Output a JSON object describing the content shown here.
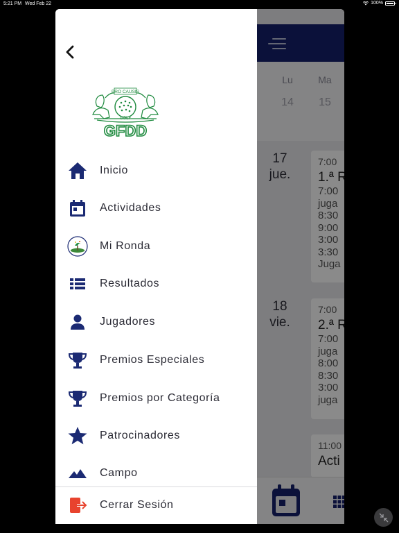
{
  "status_bar": {
    "time": "5:21 PM",
    "date": "Wed Feb 22",
    "battery": "100%"
  },
  "drawer": {
    "back_icon": "chevron-left-icon",
    "logo": {
      "motto": "PRO CAUSIS",
      "golf": "GOLF",
      "name": "GFDD"
    },
    "menu_items": [
      {
        "label": "Inicio",
        "icon": "home-icon"
      },
      {
        "label": "Actividades",
        "icon": "calendar-icon"
      },
      {
        "label": "Mi Ronda",
        "icon": "golf-ball-icon"
      },
      {
        "label": "Resultados",
        "icon": "list-icon"
      },
      {
        "label": "Jugadores",
        "icon": "person-icon"
      },
      {
        "label": "Premios Especiales",
        "icon": "trophy-icon"
      },
      {
        "label": "Premios por Categoría",
        "icon": "trophy-icon"
      },
      {
        "label": "Patrocinadores",
        "icon": "star-icon"
      },
      {
        "label": "Campo",
        "icon": "mountain-icon"
      }
    ],
    "logout": {
      "label": "Cerrar Sesión",
      "icon": "logout-icon"
    }
  },
  "background": {
    "menu_icon": "hamburger-menu-icon",
    "week_days": [
      {
        "day": "Lu",
        "num": "14"
      },
      {
        "day": "Ma",
        "num": "15"
      }
    ],
    "schedule": [
      {
        "day_num": "17",
        "day_name": "jue.",
        "card_time": "7:00",
        "card_title": "1.ª R",
        "lines": [
          "7:00",
          "juga",
          "8:30",
          "9:00",
          "3:00",
          "3:30",
          "Juga"
        ]
      },
      {
        "day_num": "18",
        "day_name": "vie.",
        "card_time": "7:00",
        "card_title": "2.ª R",
        "lines": [
          "7:00",
          "juga",
          "8:00",
          "8:30",
          "3:00",
          "juga"
        ]
      },
      {
        "card_time": "11:00",
        "card_title": "Acti"
      }
    ],
    "tabs": [
      "calendar-tab-icon",
      "grid-tab-icon"
    ]
  },
  "colors": {
    "navy": "#15216b",
    "accent_red": "#e8432e",
    "logo_green": "#1e8a3e"
  },
  "corner_button_icon": "collapse-arrows-icon"
}
